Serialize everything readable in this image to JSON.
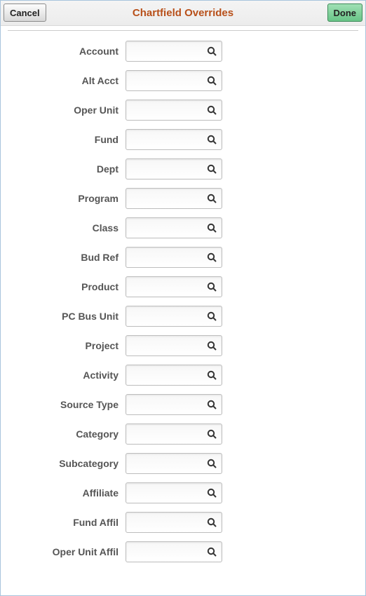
{
  "header": {
    "title": "Chartfield Overrides",
    "cancel_label": "Cancel",
    "done_label": "Done"
  },
  "fields": [
    {
      "label": "Account",
      "value": ""
    },
    {
      "label": "Alt Acct",
      "value": ""
    },
    {
      "label": "Oper Unit",
      "value": ""
    },
    {
      "label": "Fund",
      "value": ""
    },
    {
      "label": "Dept",
      "value": ""
    },
    {
      "label": "Program",
      "value": ""
    },
    {
      "label": "Class",
      "value": ""
    },
    {
      "label": "Bud Ref",
      "value": ""
    },
    {
      "label": "Product",
      "value": ""
    },
    {
      "label": "PC Bus Unit",
      "value": ""
    },
    {
      "label": "Project",
      "value": ""
    },
    {
      "label": "Activity",
      "value": ""
    },
    {
      "label": "Source Type",
      "value": ""
    },
    {
      "label": "Category",
      "value": ""
    },
    {
      "label": "Subcategory",
      "value": ""
    },
    {
      "label": "Affiliate",
      "value": ""
    },
    {
      "label": "Fund Affil",
      "value": ""
    },
    {
      "label": "Oper Unit Affil",
      "value": ""
    }
  ]
}
